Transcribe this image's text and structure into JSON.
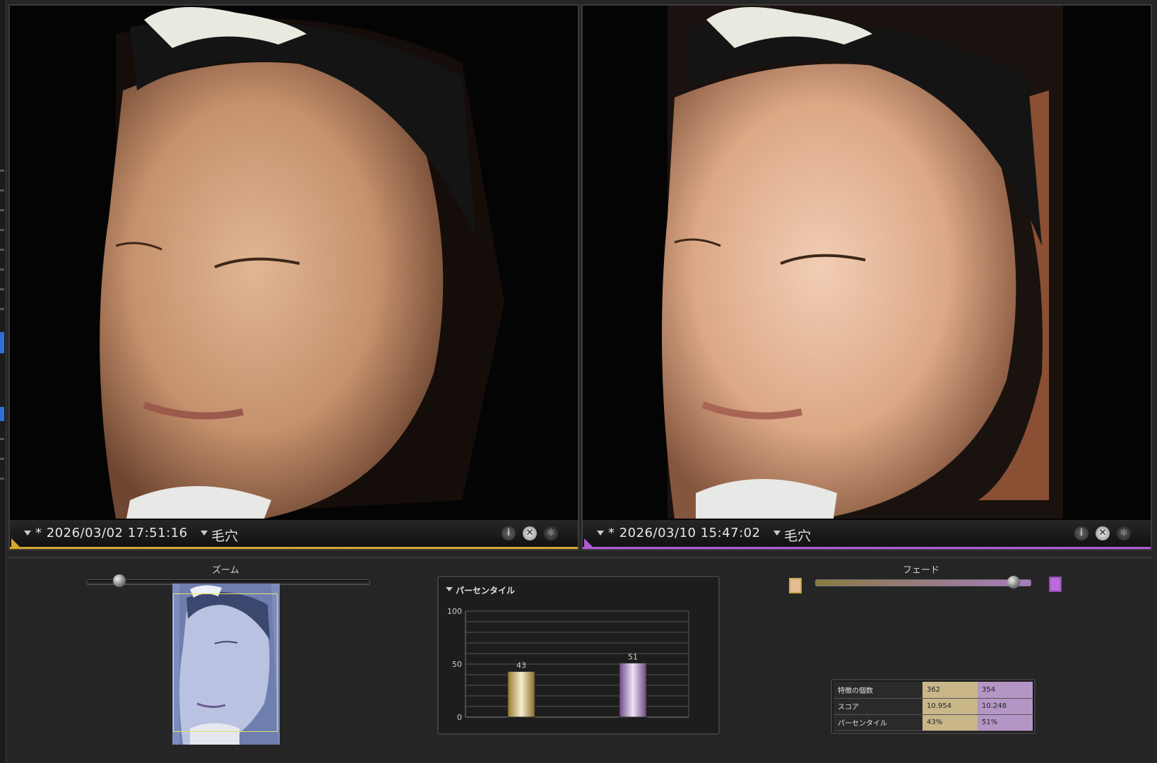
{
  "colors": {
    "accent_before": "#d4a72a",
    "accent_after": "#b05ad6",
    "background": "#262626"
  },
  "left_panel": {
    "date_label": "* 2026/03/02 17:51:16",
    "mode_label": "毛穴"
  },
  "right_panel": {
    "date_label": "* 2026/03/10 15:47:02",
    "mode_label": "毛穴"
  },
  "zoom": {
    "label": "ズーム",
    "value": 0.1
  },
  "fade": {
    "label": "フェード",
    "value": 0.95
  },
  "chart_data": {
    "type": "bar",
    "title": "パーセンタイル",
    "categories": [
      "2026/03/02 17:51:16",
      "2026/03/10 15:47:02"
    ],
    "values": [
      43,
      51
    ],
    "ylim": [
      0,
      100
    ],
    "yticks": [
      0,
      50,
      100
    ],
    "grid": true,
    "bar_colors": [
      "#c9a64a",
      "#a77bc2"
    ]
  },
  "stats_table": {
    "rows": [
      {
        "label": "特徴の個数",
        "before": "362",
        "after": "354"
      },
      {
        "label": "スコア",
        "before": "10.954",
        "after": "10.248"
      },
      {
        "label": "パーセンタイル",
        "before": "43%",
        "after": "51%"
      }
    ]
  },
  "icons": {
    "caption_info": "info-icon",
    "caption_close": "close-icon",
    "caption_settings": "gear-icon"
  }
}
